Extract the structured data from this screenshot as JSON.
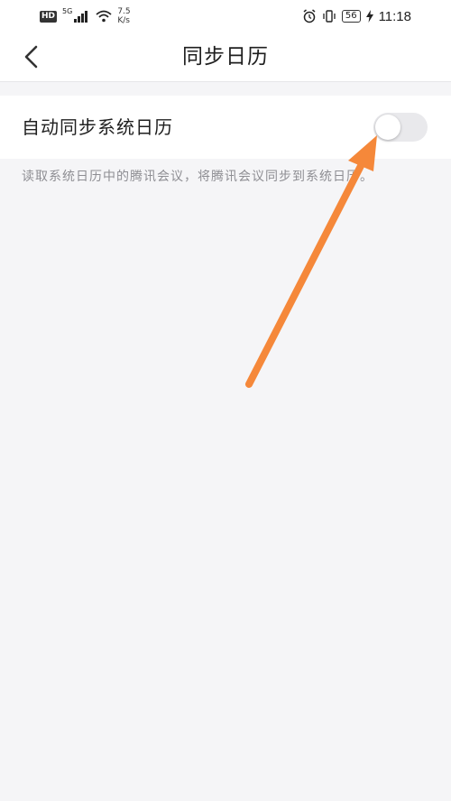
{
  "status_bar": {
    "hd": "HD",
    "net_type": "5G",
    "speed_value": "7.5",
    "speed_unit": "K/s",
    "battery": "56",
    "time": "11:18",
    "icons": [
      "signal-icon",
      "wifi-icon",
      "alarm-icon",
      "vibrate-icon",
      "charging-icon"
    ]
  },
  "header": {
    "title": "同步日历",
    "back_icon": "chevron-left-icon"
  },
  "settings": {
    "auto_sync_label": "自动同步系统日历",
    "auto_sync_enabled": false,
    "description": "读取系统日历中的腾讯会议，将腾讯会议同步到系统日历。"
  },
  "annotation": {
    "arrow_color": "#f5883a"
  },
  "colors": {
    "background": "#f5f5f7",
    "toggle_off": "#e9e9ec",
    "description_text": "#8e8e93"
  }
}
